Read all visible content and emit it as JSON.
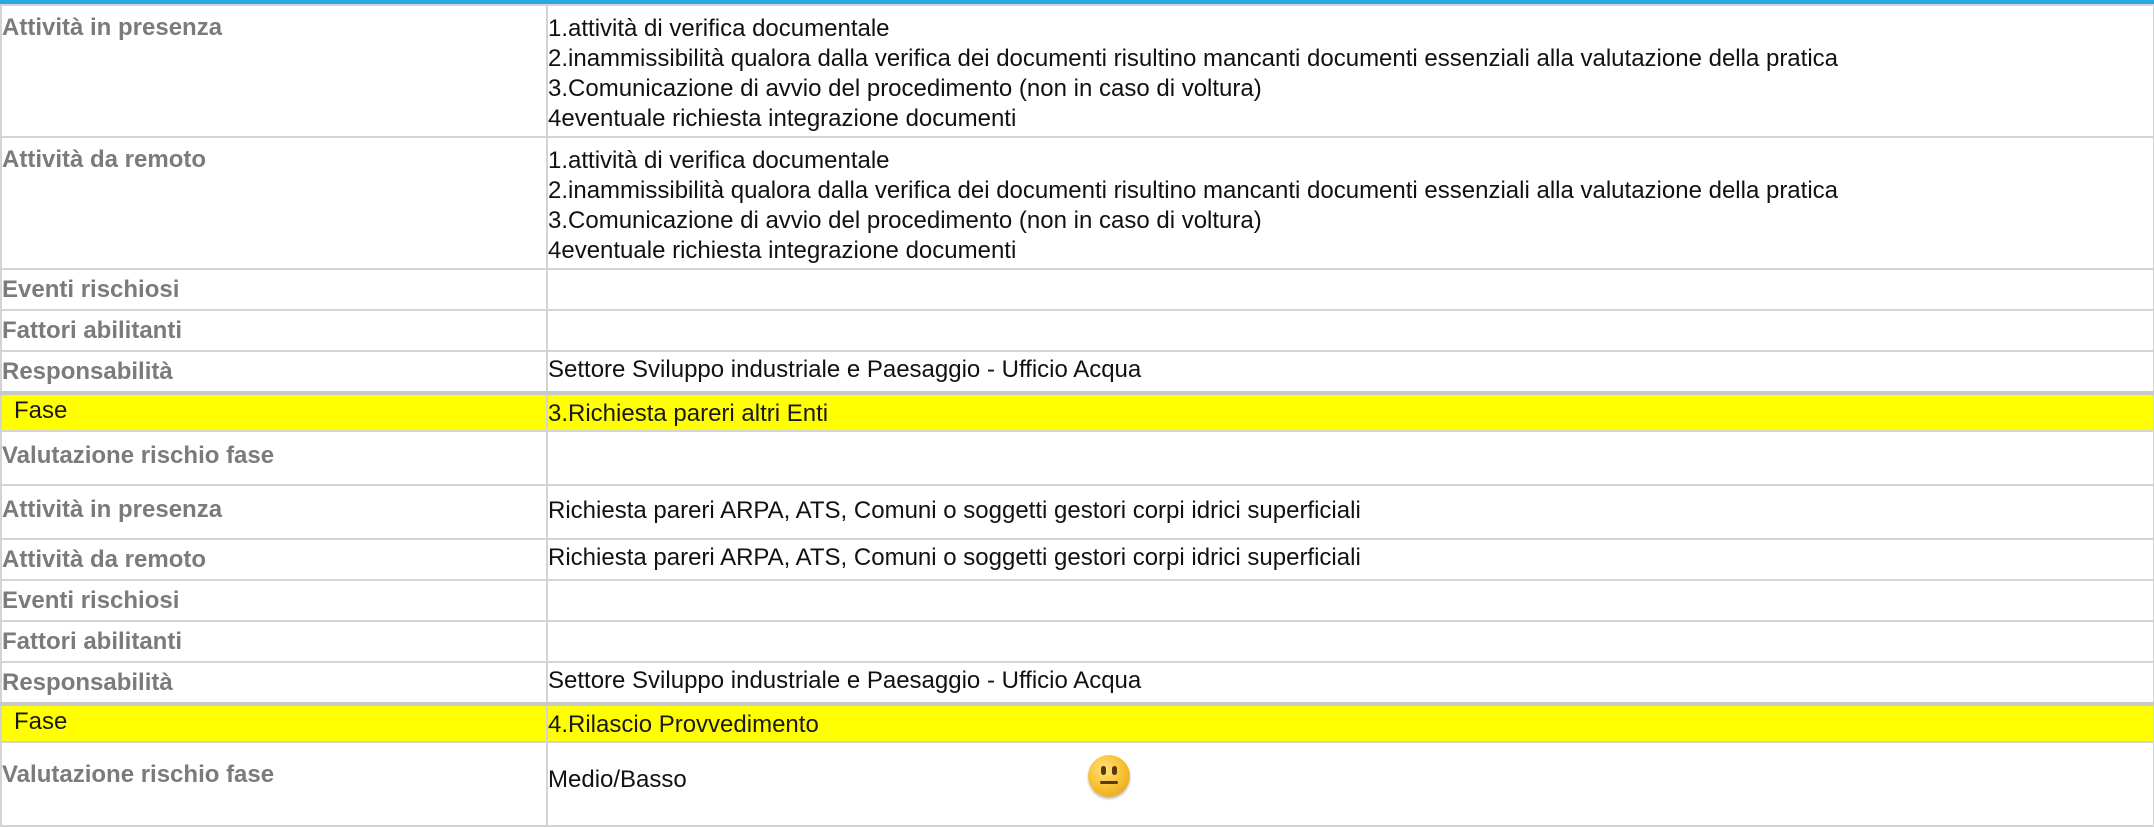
{
  "rows": [
    {
      "label": "Attività in presenza",
      "lines": [
        "1.attività di verifica documentale",
        "2.inammissibilità qualora dalla verifica dei documenti risultino mancanti documenti essenziali alla valutazione della pratica",
        "3.Comunicazione di avvio del procedimento (non in caso di voltura)",
        "4eventuale richiesta integrazione documenti"
      ]
    },
    {
      "label": "Attività da remoto",
      "lines": [
        "1.attività di verifica documentale",
        "2.inammissibilità qualora dalla verifica dei documenti risultino mancanti documenti essenziali alla valutazione della pratica",
        "3.Comunicazione di avvio del procedimento (non in caso di voltura)",
        "4eventuale richiesta integrazione documenti"
      ]
    },
    {
      "label": "Eventi rischiosi",
      "value": ""
    },
    {
      "label": "Fattori abilitanti",
      "value": ""
    },
    {
      "label": "Responsabilità",
      "value": "Settore Sviluppo industriale e Paesaggio - Ufficio Acqua"
    },
    {
      "label": "Fase",
      "value": "3.Richiesta pareri altri Enti",
      "highlight": true
    },
    {
      "label": "Valutazione rischio fase",
      "value": ""
    },
    {
      "label": "Attività in presenza",
      "value": "Richiesta pareri ARPA, ATS, Comuni o soggetti gestori corpi idrici superficiali"
    },
    {
      "label": "Attività da remoto",
      "value": "Richiesta pareri ARPA, ATS, Comuni o soggetti gestori corpi idrici superficiali"
    },
    {
      "label": "Eventi rischiosi",
      "value": ""
    },
    {
      "label": "Fattori abilitanti",
      "value": ""
    },
    {
      "label": "Responsabilità",
      "value": "Settore Sviluppo industriale e Paesaggio - Ufficio Acqua"
    },
    {
      "label": "Fase",
      "value": "4.Rilascio Provvedimento",
      "highlight": true
    },
    {
      "label": "Valutazione rischio fase",
      "value": "Medio/Basso",
      "icon": "neutral-face-emoji-icon"
    }
  ],
  "colors": {
    "top_bar": "#29a9e1",
    "highlight": "#ffff00",
    "label_text": "#7b7b7b",
    "border": "#d4d4d4"
  }
}
